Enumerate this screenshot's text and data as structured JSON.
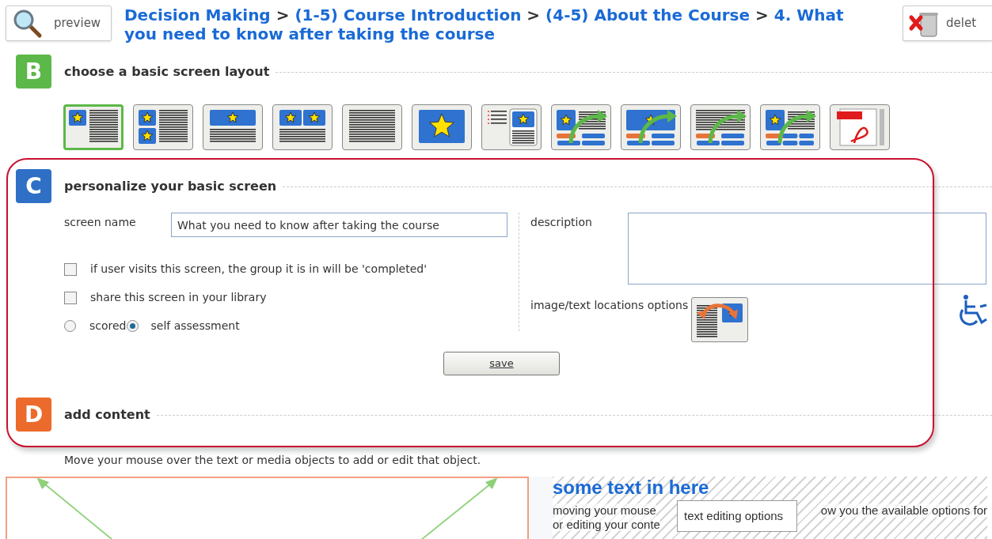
{
  "header": {
    "preview_button": "preview",
    "breadcrumb": [
      {
        "kind": "link",
        "text": "Decision Making"
      },
      {
        "kind": "separator",
        "text": ">"
      },
      {
        "kind": "link",
        "text": "(1-5) Course Introduction"
      },
      {
        "kind": "separator",
        "text": ">"
      },
      {
        "kind": "link",
        "text": "(4-5) About the Course"
      },
      {
        "kind": "separator",
        "text": ">"
      },
      {
        "kind": "link",
        "text": "4. What you need to know after taking the course"
      }
    ],
    "delete_button": "delet"
  },
  "sections": [
    {
      "kind": "layout",
      "badge": "B",
      "color": "#5cb848",
      "title": "choose a basic screen layout",
      "layouts": [
        {
          "kind": "image-left-text",
          "selected": true
        },
        {
          "kind": "two-images-left-text",
          "selected": false
        },
        {
          "kind": "image-top-text",
          "selected": false
        },
        {
          "kind": "two-images-top-text",
          "selected": false
        },
        {
          "kind": "text-only",
          "selected": false
        },
        {
          "kind": "image-only",
          "selected": false
        },
        {
          "kind": "list-image",
          "selected": false
        },
        {
          "kind": "flow-image-text",
          "selected": false
        },
        {
          "kind": "flow-image",
          "selected": false
        },
        {
          "kind": "flow-text",
          "selected": false
        },
        {
          "kind": "flow-image-text-3",
          "selected": false
        },
        {
          "kind": "pdf",
          "selected": false
        }
      ]
    },
    {
      "kind": "personalize",
      "badge": "C",
      "color": "#2f6fc6",
      "title": "personalize your basic screen",
      "screen_name": {
        "label": "screen name",
        "value": "What you need to know after taking the course"
      },
      "checkboxes": [
        {
          "label": "if user visits this screen, the group it is in will be 'completed'",
          "checked": false
        },
        {
          "label": "share this screen in your library",
          "checked": false
        }
      ],
      "radios": [
        {
          "label": "scored",
          "selected": false
        },
        {
          "label": "self assessment",
          "selected": true
        }
      ],
      "description": {
        "label": "description"
      },
      "image_text_options": {
        "label": "image/text locations options"
      },
      "save_button": "save"
    },
    {
      "kind": "content",
      "badge": "D",
      "color": "#ec6a2c",
      "title": "add content",
      "instruction": "Move your mouse over the text or media objects to add or edit that object."
    }
  ],
  "content_preview": {
    "heading": "some text in here",
    "line_1": [
      "moving your mouse",
      "ow you the available options for"
    ],
    "line_2": "or editing your conte",
    "tooltip": "text editing options"
  }
}
